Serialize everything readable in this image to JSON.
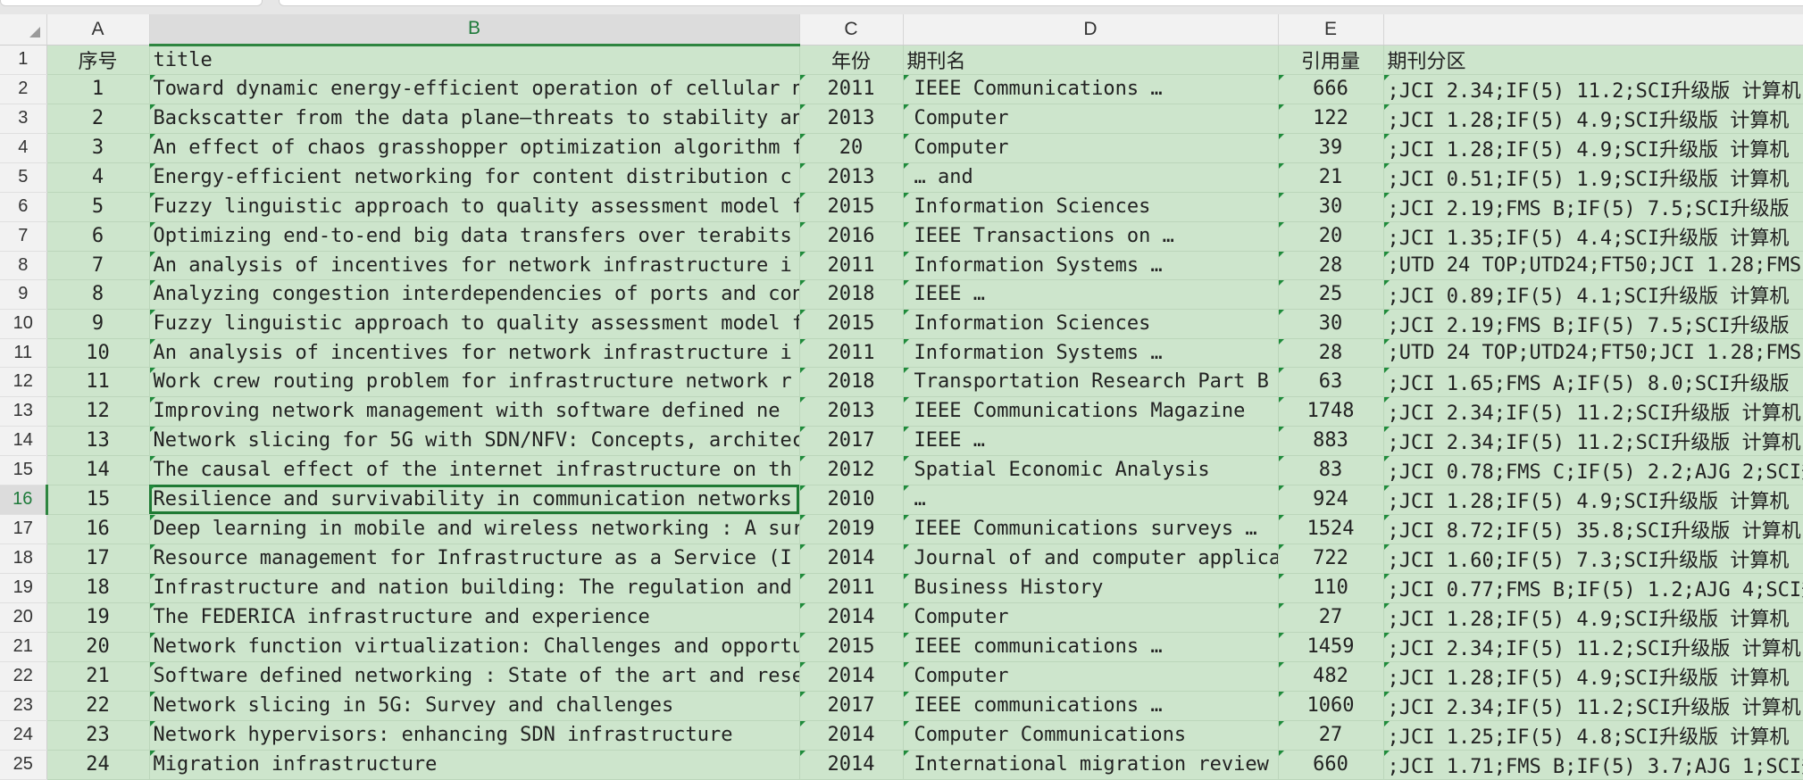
{
  "columns": [
    "A",
    "B",
    "C",
    "D",
    "E"
  ],
  "header": {
    "row_number": "1",
    "cells": [
      "序号",
      "title",
      "年份",
      "期刊名",
      "引用量",
      "期刊分区"
    ]
  },
  "rows": [
    {
      "row": "2",
      "cells": [
        "1",
        "Toward dynamic energy-efficient operation of cellular  n",
        "2011",
        "IEEE Communications  …",
        "666",
        ";JCI 2.34;IF(5) 11.2;SCI升级版 计算机"
      ]
    },
    {
      "row": "3",
      "cells": [
        "2",
        "Backscatter from the data plane–threats to stability an",
        "2013",
        "Computer",
        "122",
        ";JCI 1.28;IF(5) 4.9;SCI升级版 计算机"
      ]
    },
    {
      "row": "4",
      "cells": [
        "3",
        "An effect of chaos grasshopper optimization algorithm fc",
        "20",
        "Computer",
        "39",
        ";JCI 1.28;IF(5) 4.9;SCI升级版 计算机"
      ]
    },
    {
      "row": "5",
      "cells": [
        "4",
        "Energy-efficient  networking  for content distribution c",
        "2013",
        "…  and",
        "21",
        ";JCI 0.51;IF(5) 1.9;SCI升级版 计算机"
      ]
    },
    {
      "row": "6",
      "cells": [
        "5",
        "Fuzzy linguistic approach to quality assessment model fc",
        "2015",
        "Information Sciences",
        "30",
        ";JCI 2.19;FMS B;IF(5) 7.5;SCI升级版"
      ]
    },
    {
      "row": "7",
      "cells": [
        "6",
        "Optimizing end-to-end big data transfers over terabits",
        "2016",
        "IEEE Transactions on  …",
        "20",
        ";JCI 1.35;IF(5) 4.4;SCI升级版 计算机"
      ]
    },
    {
      "row": "8",
      "cells": [
        "7",
        "An analysis of incentives for  network infrastructure  i",
        "2011",
        "Information Systems  …",
        "28",
        ";UTD 24 TOP;UTD24;FT50;JCI 1.28;FMS"
      ]
    },
    {
      "row": "9",
      "cells": [
        "8",
        "Analyzing congestion interdependencies of ports and cont",
        "2018",
        "IEEE  …",
        "25",
        ";JCI 0.89;IF(5) 4.1;SCI升级版 计算机"
      ]
    },
    {
      "row": "10",
      "cells": [
        "9",
        "Fuzzy linguistic approach to quality assessment model fc",
        "2015",
        "Information Sciences",
        "30",
        ";JCI 2.19;FMS B;IF(5) 7.5;SCI升级版"
      ]
    },
    {
      "row": "11",
      "cells": [
        "10",
        "An analysis of incentives for  network infrastructure  i",
        "2011",
        "Information Systems  …",
        "28",
        ";UTD 24 TOP;UTD24;FT50;JCI 1.28;FMS"
      ]
    },
    {
      "row": "12",
      "cells": [
        "11",
        "Work crew routing problem for  infrastructure network  r",
        "2018",
        "Transportation Research Part B",
        "63",
        ";JCI 1.65;FMS A;IF(5) 8.0;SCI升级版"
      ]
    },
    {
      "row": "13",
      "cells": [
        "12",
        "Improving  network  management with software defined  ne",
        "2013",
        "IEEE Communications Magazine",
        "1748",
        ";JCI 2.34;IF(5) 11.2;SCI升级版 计算机"
      ]
    },
    {
      "row": "14",
      "cells": [
        "13",
        "Network  slicing for 5G with SDN/NFV: Concepts, architec",
        "2017",
        "IEEE  …",
        "883",
        ";JCI 2.34;IF(5) 11.2;SCI升级版 计算机"
      ]
    },
    {
      "row": "15",
      "cells": [
        "14",
        "The causal effect of the internet  infrastructure  on th",
        "2012",
        "Spatial Economic Analysis",
        "83",
        ";JCI 0.78;FMS C;IF(5) 2.2;AJG 2;SCI升"
      ]
    },
    {
      "row": "16",
      "cells": [
        "15",
        "Resilience and survivability in communication  networks",
        "2010",
        "…",
        "924",
        ";JCI 1.28;IF(5) 4.9;SCI升级版 计算机"
      ]
    },
    {
      "row": "17",
      "cells": [
        "16",
        "Deep learning in mobile and wireless  networking : A sur",
        "2019",
        "IEEE Communications surveys  …",
        "1524",
        ";JCI 8.72;IF(5) 35.8;SCI升级版 计算机"
      ]
    },
    {
      "row": "18",
      "cells": [
        "17",
        "Resource management for  Infrastructure  as a Service (I",
        "2014",
        "Journal of and computer applica",
        "722",
        ";JCI 1.60;IF(5) 7.3;SCI升级版 计算机"
      ]
    },
    {
      "row": "19",
      "cells": [
        "18",
        "Infrastructure  and nation building: The regulation and",
        "2011",
        "Business History",
        "110",
        ";JCI 0.77;FMS B;IF(5) 1.2;AJG 4;SCI升"
      ]
    },
    {
      "row": "20",
      "cells": [
        "19",
        "The FEDERICA  infrastructure  and experience",
        "2014",
        "Computer",
        "27",
        ";JCI 1.28;IF(5) 4.9;SCI升级版 计算机"
      ]
    },
    {
      "row": "21",
      "cells": [
        "20",
        "Network  function virtualization: Challenges and opportu",
        "2015",
        "IEEE communications  …",
        "1459",
        ";JCI 2.34;IF(5) 11.2;SCI升级版 计算机"
      ]
    },
    {
      "row": "22",
      "cells": [
        "21",
        "Software defined  networking : State of the art and rese",
        "2014",
        "Computer",
        "482",
        ";JCI 1.28;IF(5) 4.9;SCI升级版 计算机"
      ]
    },
    {
      "row": "23",
      "cells": [
        "22",
        "Network  slicing in 5G: Survey and challenges",
        "2017",
        "IEEE communications  …",
        "1060",
        ";JCI 2.34;IF(5) 11.2;SCI升级版 计算机"
      ]
    },
    {
      "row": "24",
      "cells": [
        "23",
        "Network  hypervisors: enhancing SDN  infrastructure",
        "2014",
        "Computer Communications",
        "27",
        ";JCI 1.25;IF(5) 4.8;SCI升级版 计算机"
      ]
    },
    {
      "row": "25",
      "cells": [
        "24",
        "Migration  infrastructure",
        "2014",
        "International migration review",
        "660",
        ";JCI 1.71;FMS B;IF(5) 3.7;AJG 1;SCI升"
      ]
    }
  ],
  "selection": {
    "column": "B",
    "row": "16"
  },
  "colors": {
    "cell_fill": "#cde5cc",
    "selection_green": "#2e8540",
    "header_gray": "#f2f2f2"
  }
}
